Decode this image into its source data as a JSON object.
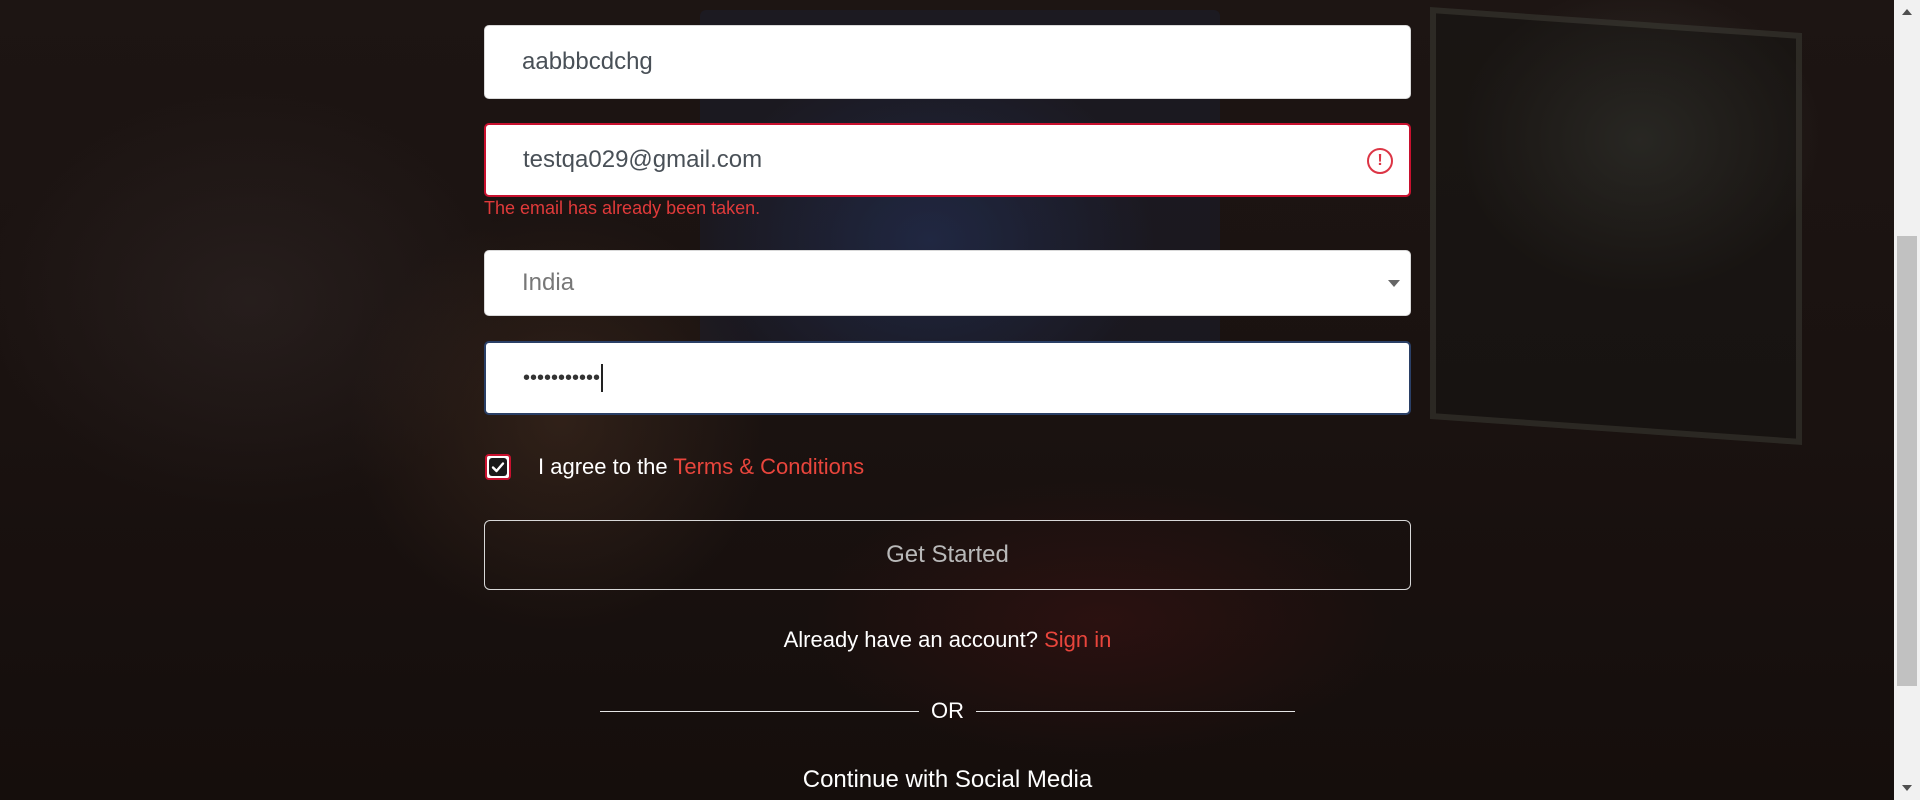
{
  "form": {
    "username": {
      "value": "aabbbcdchg"
    },
    "email": {
      "value": "testqa029@gmail.com",
      "error_icon": "alert-circle-icon",
      "error_message": "The email has already been taken."
    },
    "country": {
      "value": "India",
      "icon": "caret-down-icon"
    },
    "password": {
      "value": "•••••••••••"
    },
    "terms": {
      "checked": true,
      "label_prefix": "I agree to the ",
      "link_text": "Terms & Conditions"
    },
    "submit_label": "Get Started",
    "signin": {
      "prompt": "Already have an account? ",
      "link_text": "Sign in"
    },
    "divider_text": "OR",
    "social_heading": "Continue with Social Media"
  },
  "colors": {
    "accent": "#e8453c",
    "error": "#dc3545",
    "background": "#1a1210"
  }
}
